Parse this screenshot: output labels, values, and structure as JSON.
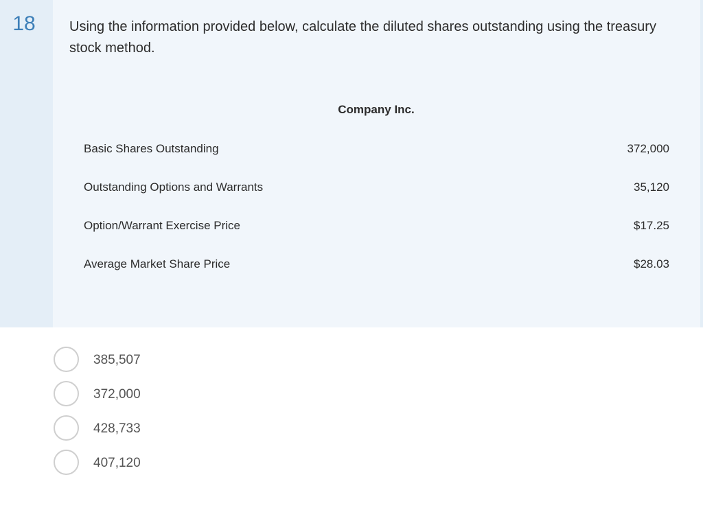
{
  "question": {
    "number": "18",
    "text": "Using the information provided below, calculate the diluted shares outstanding using the treasury stock method."
  },
  "table": {
    "title": "Company Inc.",
    "rows": [
      {
        "label": "Basic Shares Outstanding",
        "value": "372,000"
      },
      {
        "label": "Outstanding Options and Warrants",
        "value": "35,120"
      },
      {
        "label": "Option/Warrant Exercise Price",
        "value": "$17.25"
      },
      {
        "label": "Average Market Share Price",
        "value": "$28.03"
      }
    ]
  },
  "answers": [
    {
      "label": "385,507"
    },
    {
      "label": "372,000"
    },
    {
      "label": "428,733"
    },
    {
      "label": "407,120"
    }
  ],
  "colors": {
    "panel_background": "#f1f6fb",
    "gutter_background": "#e4eef7",
    "number_color": "#3d7fb8"
  }
}
